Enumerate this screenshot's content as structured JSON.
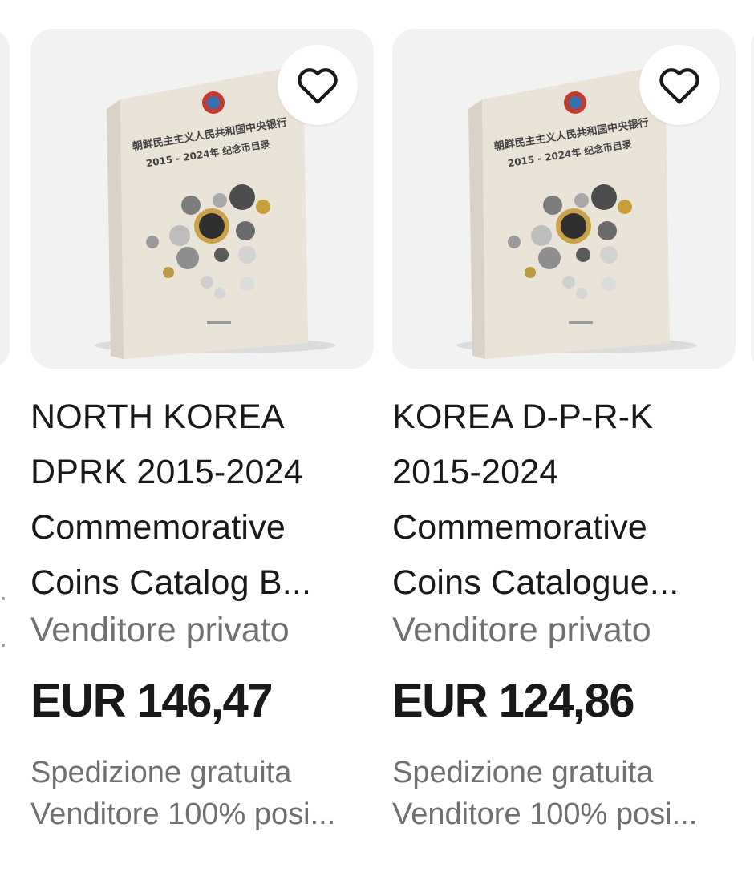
{
  "listings": [
    {
      "title_lines": [
        "NORTH KOREA",
        "DPRK 2015-2024",
        "Commemorative",
        "Coins Catalog B..."
      ],
      "seller_type": "Venditore privato",
      "price": "EUR 146,47",
      "shipping": "Spedizione gratuita",
      "seller_rating": "Venditore 100% posi...",
      "favorite_icon": "heart-outline-icon",
      "image": {
        "cn_title": "朝鲜民主主义人民共和国中央银行",
        "cn_subtitle": "2015 - 2024年 纪念币目录"
      }
    },
    {
      "title_lines": [
        "KOREA D-P-R-K",
        "2015-2024",
        "Commemorative",
        "Coins Catalogue..."
      ],
      "seller_type": "Venditore privato",
      "price": "EUR 124,86",
      "shipping": "Spedizione gratuita",
      "seller_rating": "Venditore 100% posi...",
      "favorite_icon": "heart-outline-icon",
      "image": {
        "cn_title": "朝鲜民主主义人民共和国中央银行",
        "cn_subtitle": "2015 - 2024年 纪念币目录"
      }
    }
  ],
  "colors": {
    "text_primary": "#191919",
    "text_secondary": "#707070",
    "image_bg": "#f2f2f2",
    "book_cover": "#e9e3d8"
  }
}
